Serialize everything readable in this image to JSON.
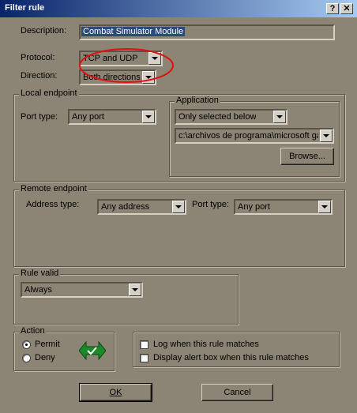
{
  "window": {
    "title": "Filter rule",
    "help_label": "?",
    "close_label": "✕"
  },
  "description": {
    "label": "Description:",
    "value": "Combat Simulator Module"
  },
  "protocol": {
    "label": "Protocol:",
    "value": "TCP and UDP"
  },
  "direction": {
    "label": "Direction:",
    "value": "Both directions"
  },
  "local_endpoint": {
    "title": "Local endpoint",
    "port_type_label": "Port type:",
    "port_type_value": "Any port"
  },
  "application": {
    "title": "Application",
    "mode_value": "Only selected below",
    "path_value": "c:\\archivos de programa\\microsoft ga",
    "browse_label": "Browse..."
  },
  "remote_endpoint": {
    "title": "Remote endpoint",
    "address_type_label": "Address type:",
    "address_type_value": "Any address",
    "port_type_label": "Port type:",
    "port_type_value": "Any port"
  },
  "rule_valid": {
    "title": "Rule valid",
    "value": "Always"
  },
  "action": {
    "title": "Action",
    "permit_label": "Permit",
    "deny_label": "Deny",
    "selected": "Permit",
    "icon": "permit-arrows-icon",
    "icon_color": "#1a8a2a"
  },
  "options": {
    "log_label": "Log when this rule matches",
    "alert_label": "Display alert box when this rule matches"
  },
  "buttons": {
    "ok_label": "OK",
    "cancel_label": "Cancel"
  },
  "colors": {
    "dialog_bg": "#8c8474",
    "highlight_circle": "#e01010",
    "title_bar": "#0a246a"
  }
}
